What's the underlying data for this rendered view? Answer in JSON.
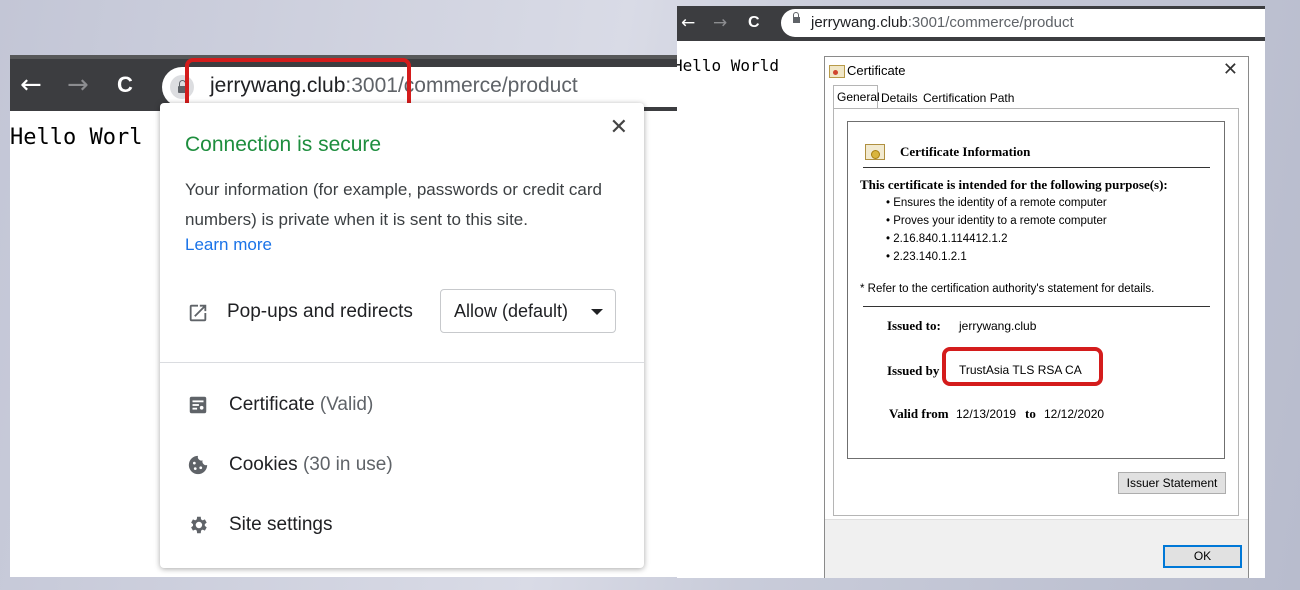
{
  "left_browser": {
    "url_host": "jerrywang.club",
    "url_port": ":3001",
    "url_path": "/commerce/product",
    "page_text": "Hello Worl",
    "nav": {
      "back": "←",
      "forward": "→",
      "reload": "C"
    },
    "popup": {
      "close": "✕",
      "title": "Connection is secure",
      "description": "Your information (for example, passwords or credit card numbers) is private when it is sent to this site.",
      "learn_more": "Learn more",
      "popups_label": "Pop-ups and redirects",
      "popups_value": "Allow (default)",
      "certificate_label": "Certificate",
      "certificate_status": "(Valid)",
      "cookies_label": "Cookies",
      "cookies_status": "(30 in use)",
      "site_settings_label": "Site settings"
    }
  },
  "right_browser": {
    "url_host": "jerrywang.club",
    "url_rest": ":3001/commerce/product",
    "page_text": "Hello World",
    "nav": {
      "back": "←",
      "forward": "→",
      "reload": "C"
    },
    "dialog": {
      "title": "Certificate",
      "close": "✕",
      "tabs": [
        "General",
        "Details",
        "Certification Path"
      ],
      "info_title": "Certificate Information",
      "purpose_heading": "This certificate is intended for the following purpose(s):",
      "purposes": [
        "• Ensures the identity of a remote computer",
        "• Proves your identity to a remote computer",
        "• 2.16.840.1.114412.1.2",
        "• 2.23.140.1.2.1"
      ],
      "refer_note": "* Refer to the certification authority's statement for details.",
      "issued_to_label": "Issued to:",
      "issued_to_value": "jerrywang.club",
      "issued_by_label": "Issued by",
      "issued_by_value": "TrustAsia TLS RSA CA",
      "valid_from_label": "Valid from",
      "valid_from_value": "12/13/2019",
      "valid_to_label": "to",
      "valid_to_value": "12/12/2020",
      "issuer_statement_button": "Issuer Statement",
      "ok_button": "OK"
    }
  },
  "colors": {
    "secure_green": "#1e8e3e",
    "link_blue": "#1a73e8",
    "highlight_red": "#d41c1c",
    "toolbar_dark": "#3c3d40"
  }
}
